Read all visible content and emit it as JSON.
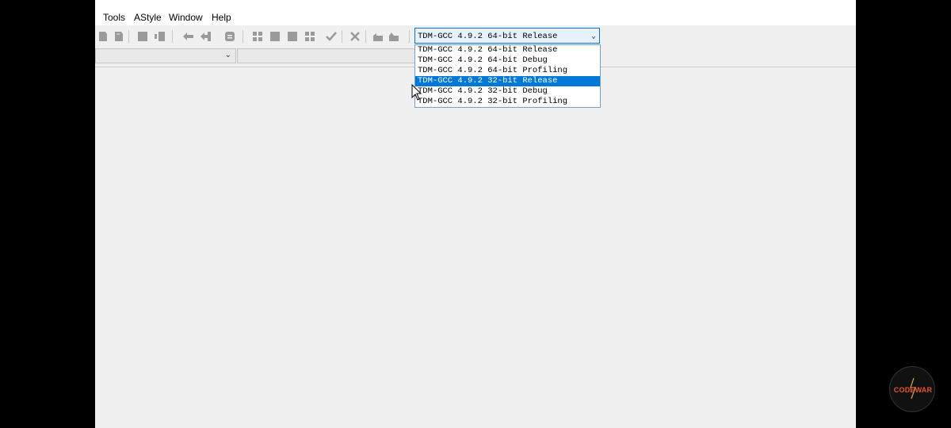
{
  "menu": {
    "items": [
      {
        "label": "Tools"
      },
      {
        "label": "AStyle"
      },
      {
        "label": "Window"
      },
      {
        "label": "Help"
      }
    ]
  },
  "toolbar": {
    "icons": [
      "bookmark-icon",
      "bookmark-icon",
      "insert-icon",
      "goto-icon",
      "unindent-icon",
      "indent-icon",
      "toggle-comment-icon",
      "compile-icon",
      "run-icon",
      "compile-run-icon",
      "rebuild-icon",
      "syntax-check-icon",
      "stop-icon",
      "new-project-icon",
      "project-options-icon"
    ]
  },
  "compiler": {
    "selected": "TDM-GCC 4.9.2 64-bit Release",
    "options": [
      "TDM-GCC 4.9.2 64-bit Release",
      "TDM-GCC 4.9.2 64-bit Debug",
      "TDM-GCC 4.9.2 64-bit Profiling",
      "TDM-GCC 4.9.2 32-bit Release",
      "TDM-GCC 4.9.2 32-bit Debug",
      "TDM-GCC 4.9.2 32-bit Profiling"
    ],
    "highlighted_index": 3
  },
  "watermark": {
    "text": "CODEWAR"
  },
  "colors": {
    "selection": "#0078d7",
    "logo_text": "#e8532a"
  }
}
